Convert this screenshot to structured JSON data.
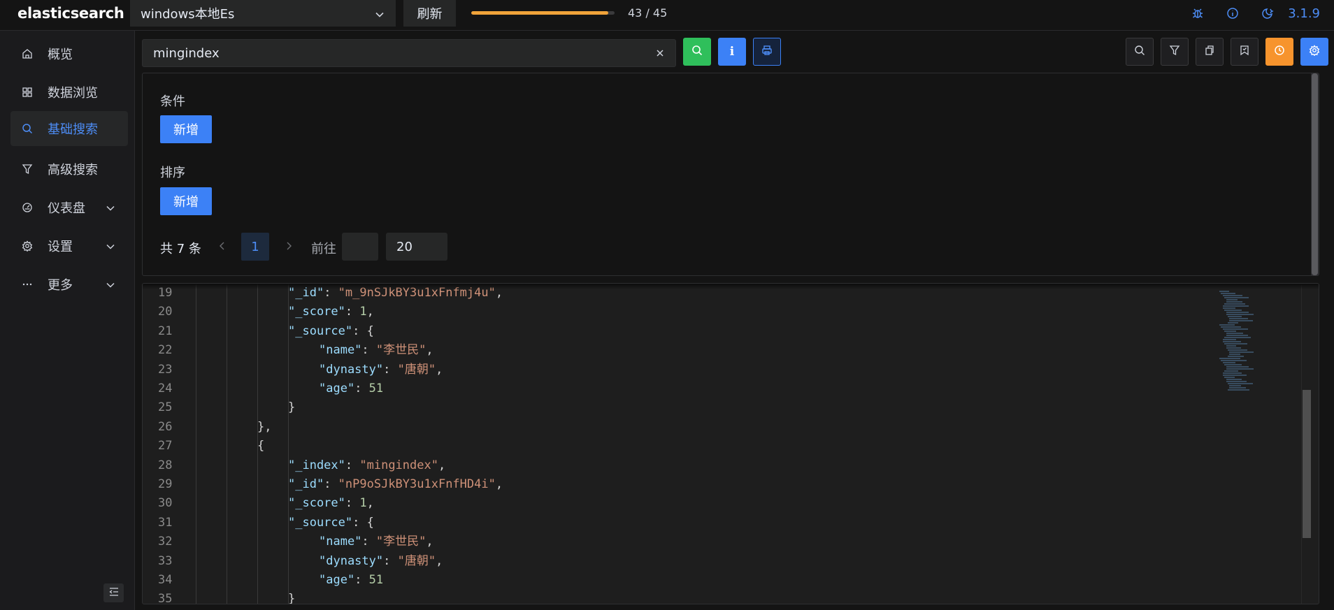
{
  "app": {
    "brand": "elasticsearch",
    "version": "3.1.9"
  },
  "topbar": {
    "connection": "windows本地Es",
    "refresh_label": "刷新",
    "progress_text": "43 / 45",
    "progress_fraction": 0.956
  },
  "sidebar": {
    "items": [
      {
        "label": "概览",
        "icon": "home-icon"
      },
      {
        "label": "数据浏览",
        "icon": "grid-icon"
      },
      {
        "label": "基础搜索",
        "icon": "search-icon",
        "active": true
      },
      {
        "label": "高级搜索",
        "icon": "filter-icon"
      },
      {
        "label": "仪表盘",
        "icon": "dashboard-icon",
        "expandable": true
      },
      {
        "label": "设置",
        "icon": "gear-icon",
        "expandable": true
      },
      {
        "label": "更多",
        "icon": "more-icon",
        "expandable": true
      }
    ]
  },
  "search": {
    "index_value": "mingindex",
    "info_label": "i"
  },
  "conditions": {
    "condition_label": "条件",
    "sort_label": "排序",
    "add_label": "新增"
  },
  "pager": {
    "total": "共 7 条",
    "current_page": "1",
    "goto_label": "前往",
    "goto_value": "",
    "page_size": "20"
  },
  "colors": {
    "accent": "#3c81f6",
    "success": "#2fbf5b",
    "warning": "#f7942d",
    "progress": "#f0a33a"
  },
  "editor": {
    "lines": [
      {
        "n": "19",
        "indent": 4,
        "tokens": [
          [
            "k",
            "\"_id\""
          ],
          [
            "p",
            ": "
          ],
          [
            "s",
            "\"m_9nSJkBY3u1xFnfmj4u\""
          ],
          [
            "p",
            ","
          ]
        ]
      },
      {
        "n": "20",
        "indent": 4,
        "tokens": [
          [
            "k",
            "\"_score\""
          ],
          [
            "p",
            ": "
          ],
          [
            "n",
            "1"
          ],
          [
            "p",
            ","
          ]
        ]
      },
      {
        "n": "21",
        "indent": 4,
        "tokens": [
          [
            "k",
            "\"_source\""
          ],
          [
            "p",
            ": {"
          ]
        ]
      },
      {
        "n": "22",
        "indent": 5,
        "tokens": [
          [
            "k",
            "\"name\""
          ],
          [
            "p",
            ": "
          ],
          [
            "s",
            "\"李世民\""
          ],
          [
            "p",
            ","
          ]
        ]
      },
      {
        "n": "23",
        "indent": 5,
        "tokens": [
          [
            "k",
            "\"dynasty\""
          ],
          [
            "p",
            ": "
          ],
          [
            "s",
            "\"唐朝\""
          ],
          [
            "p",
            ","
          ]
        ]
      },
      {
        "n": "24",
        "indent": 5,
        "tokens": [
          [
            "k",
            "\"age\""
          ],
          [
            "p",
            ": "
          ],
          [
            "n",
            "51"
          ]
        ]
      },
      {
        "n": "25",
        "indent": 4,
        "tokens": [
          [
            "p",
            "}"
          ]
        ]
      },
      {
        "n": "26",
        "indent": 3,
        "tokens": [
          [
            "p",
            "},"
          ]
        ]
      },
      {
        "n": "27",
        "indent": 3,
        "tokens": [
          [
            "p",
            "{"
          ]
        ]
      },
      {
        "n": "28",
        "indent": 4,
        "tokens": [
          [
            "k",
            "\"_index\""
          ],
          [
            "p",
            ": "
          ],
          [
            "s",
            "\"mingindex\""
          ],
          [
            "p",
            ","
          ]
        ]
      },
      {
        "n": "29",
        "indent": 4,
        "tokens": [
          [
            "k",
            "\"_id\""
          ],
          [
            "p",
            ": "
          ],
          [
            "s",
            "\"nP9oSJkBY3u1xFnfHD4i\""
          ],
          [
            "p",
            ","
          ]
        ]
      },
      {
        "n": "30",
        "indent": 4,
        "tokens": [
          [
            "k",
            "\"_score\""
          ],
          [
            "p",
            ": "
          ],
          [
            "n",
            "1"
          ],
          [
            "p",
            ","
          ]
        ]
      },
      {
        "n": "31",
        "indent": 4,
        "tokens": [
          [
            "k",
            "\"_source\""
          ],
          [
            "p",
            ": {"
          ]
        ]
      },
      {
        "n": "32",
        "indent": 5,
        "tokens": [
          [
            "k",
            "\"name\""
          ],
          [
            "p",
            ": "
          ],
          [
            "s",
            "\"李世民\""
          ],
          [
            "p",
            ","
          ]
        ]
      },
      {
        "n": "33",
        "indent": 5,
        "tokens": [
          [
            "k",
            "\"dynasty\""
          ],
          [
            "p",
            ": "
          ],
          [
            "s",
            "\"唐朝\""
          ],
          [
            "p",
            ","
          ]
        ]
      },
      {
        "n": "34",
        "indent": 5,
        "tokens": [
          [
            "k",
            "\"age\""
          ],
          [
            "p",
            ": "
          ],
          [
            "n",
            "51"
          ]
        ]
      },
      {
        "n": "35",
        "indent": 4,
        "tokens": [
          [
            "p",
            "}"
          ]
        ]
      }
    ]
  }
}
